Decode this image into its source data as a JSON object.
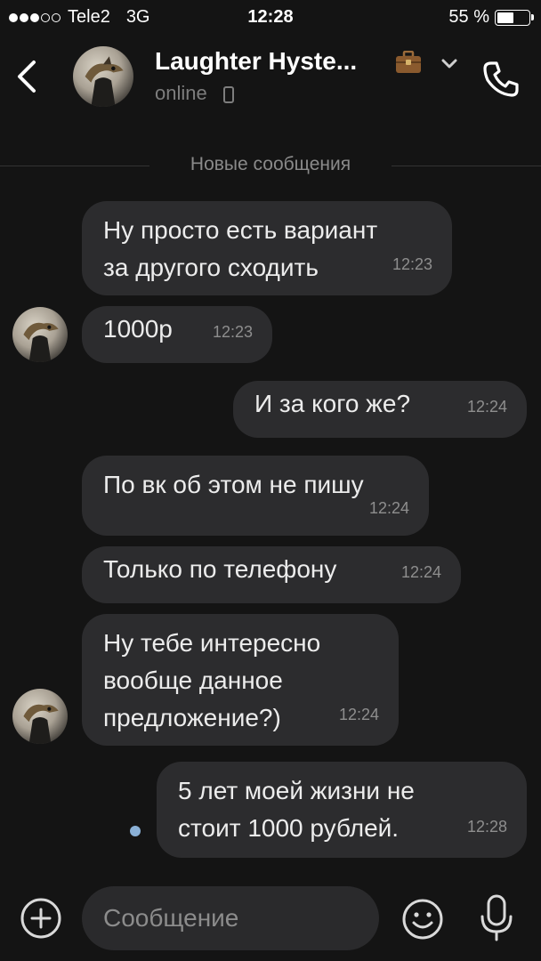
{
  "status_bar": {
    "carrier": "Tele2",
    "network": "3G",
    "time": "12:28",
    "battery": "55 %",
    "battery_level": 0.55,
    "signal_bars": 3
  },
  "header": {
    "contact_name": "Laughter Hyste...",
    "status": "online",
    "icons": [
      "back-chevron-icon",
      "briefcase-icon",
      "chevron-down-icon",
      "phone-icon",
      "mobile-device-icon"
    ]
  },
  "divider": {
    "label": "Новые сообщения"
  },
  "messages": [
    {
      "direction": "in",
      "text": "Ну просто есть вариант\nза другого сходить",
      "time": "12:23"
    },
    {
      "direction": "in",
      "text": "1000р",
      "time": "12:23"
    },
    {
      "direction": "out",
      "text": "И за кого же?",
      "time": "12:24"
    },
    {
      "direction": "in",
      "text": "По вк об этом не пишу",
      "time": "12:24"
    },
    {
      "direction": "in",
      "text": "Только по телефону",
      "time": "12:24"
    },
    {
      "direction": "in",
      "text": "Ну тебе интересно\nвообще данное\nпредложение?)",
      "time": "12:24"
    },
    {
      "direction": "out",
      "text": "5 лет моей жизни не\nстоит 1000 рублей.",
      "time": "12:28",
      "unread": true
    }
  ],
  "composer": {
    "placeholder": "Сообщение",
    "icons": [
      "add-icon",
      "emoji-icon",
      "microphone-icon"
    ]
  },
  "colors": {
    "background": "#141414",
    "bubble": "#2c2c2e",
    "unread_dot": "#8ab0d6",
    "timestamp": "#8e8e8e"
  }
}
